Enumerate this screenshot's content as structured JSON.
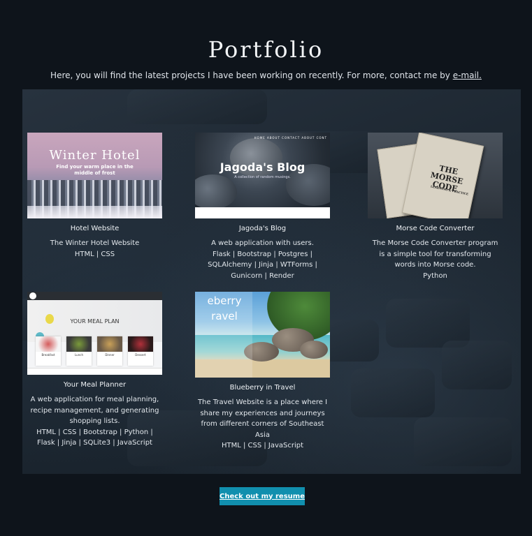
{
  "header": {
    "title": "Portfolio",
    "subtitle_text": "Here, you will find the latest projects I have been working on recently. For more, contact me by ",
    "email_link": "e-mail."
  },
  "projects": [
    {
      "title": "Hotel Website",
      "description": "The Winter Hotel Website",
      "tech": "HTML | CSS",
      "thumb_title": "Winter Hotel",
      "thumb_subtitle": "Find your warm place in the middle of frost"
    },
    {
      "title": "Jagoda's Blog",
      "description": "A web application with users.",
      "tech": "Flask | Bootstrap | Postgres | SQLAlchemy | Jinja | WTForms | Gunicorn | Render",
      "thumb_title": "Jagoda's Blog",
      "thumb_subtitle": "A collection of random musings.",
      "thumb_nav": "HOME  ABOUT  CONTACT  ABOUT  CONT"
    },
    {
      "title": "Morse Code Converter",
      "description": "The Morse Code Converter program is a simple tool for transforming words into Morse code.",
      "tech": "Python",
      "thumb_title": "THE MORSE CODE",
      "thumb_subtitle": "LEARNING & PRACTICE"
    },
    {
      "title": "Your Meal Planner",
      "description": "A web application for meal planning, recipe management, and generating shopping lists.",
      "tech": "HTML | CSS | Bootstrap | Python | Flask | Jinja | SQLite3 | JavaScript",
      "thumb_title": "YOUR MEAL PLAN",
      "thumb_dishes": [
        "Breakfast",
        "Lunch",
        "Dinner",
        "Dessert"
      ]
    },
    {
      "title": "Blueberry in Travel",
      "description": "The Travel Website is a place where I share my experiences and journeys from different corners of Southeast Asia",
      "tech": "HTML | CSS | JavaScript",
      "thumb_text": "eberry ravel"
    }
  ],
  "resume_button": "Check out my resume",
  "colors": {
    "background": "#0e141b",
    "button": "#118fae"
  }
}
